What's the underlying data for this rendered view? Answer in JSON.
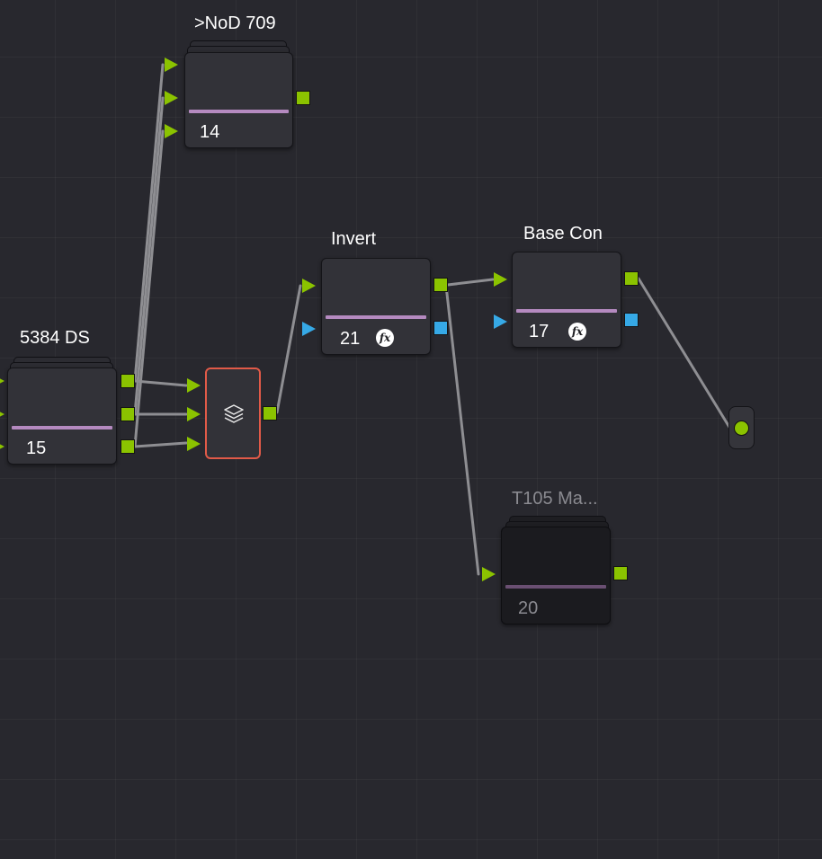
{
  "nodes": {
    "nod709": {
      "title": ">NoD 709",
      "number": "14"
    },
    "ds5384": {
      "title": "5384 DS",
      "number": "15"
    },
    "invert": {
      "title": "Invert",
      "number": "21"
    },
    "basecon": {
      "title": "Base Con",
      "number": "17"
    },
    "t105": {
      "title": "T105 Ma...",
      "number": "20"
    },
    "layer_mixer": {
      "icon": "layers-icon"
    },
    "media_out": {
      "icon": "output-dot-icon"
    }
  },
  "fx_label": "fx",
  "colors": {
    "background": "#28282e",
    "port_green": "#8bc300",
    "port_blue": "#36a9e6",
    "selection_border": "#e15a48",
    "node_bar": "#b58ac0",
    "link": "#8e8e92"
  }
}
